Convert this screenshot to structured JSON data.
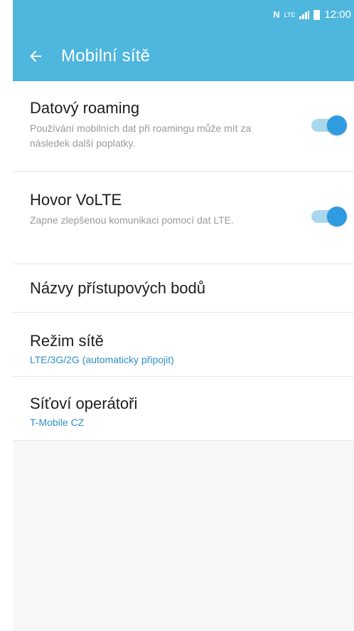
{
  "status_bar": {
    "nfc_icon": "nfc-icon",
    "network_type": "LTE",
    "time": "12:00"
  },
  "app_bar": {
    "title": "Mobilní sítě",
    "back_icon": "arrow-left-icon"
  },
  "settings": [
    {
      "title": "Datový roaming",
      "subtitle": "Používání mobilních dat při roamingu může mít za následek další poplatky.",
      "toggle": true
    },
    {
      "title": "Hovor VoLTE",
      "subtitle": "Zapne zlepšenou komunikaci pomocí dat LTE.",
      "toggle": true
    },
    {
      "title": "Názvy přístupových bodů"
    },
    {
      "title": "Režim sítě",
      "value": "LTE/3G/2G (automaticky připojit)"
    },
    {
      "title": "Síťoví operátoři",
      "value": "T-Mobile CZ"
    }
  ],
  "colors": {
    "header": "#4fb6de",
    "accent": "#2f9be0",
    "value_text": "#2f8fc8"
  }
}
